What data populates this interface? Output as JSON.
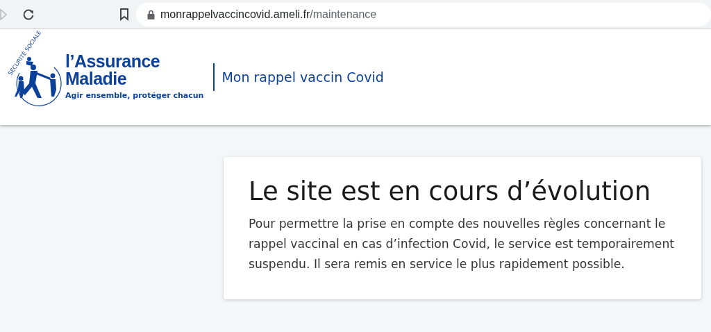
{
  "browser": {
    "url_host": "monrappelvaccincovid.ameli.fr",
    "url_path": "/maintenance"
  },
  "header": {
    "logo": {
      "arc_text": "SÉCURITÉ SOCIALE",
      "line_1": "l’Assurance",
      "line_2": "Maladie",
      "tagline": "Agir ensemble, protéger chacun"
    },
    "site_name": "Mon rappel vaccin Covid"
  },
  "notice": {
    "title": "Le site est en cours d’évolution",
    "body": "Pour permettre la prise en compte des nouvelles règles concernant le rappel vaccinal en cas d’infection Covid, le service est temporairement suspendu. Il sera remis en service le plus rapidement possible."
  }
}
